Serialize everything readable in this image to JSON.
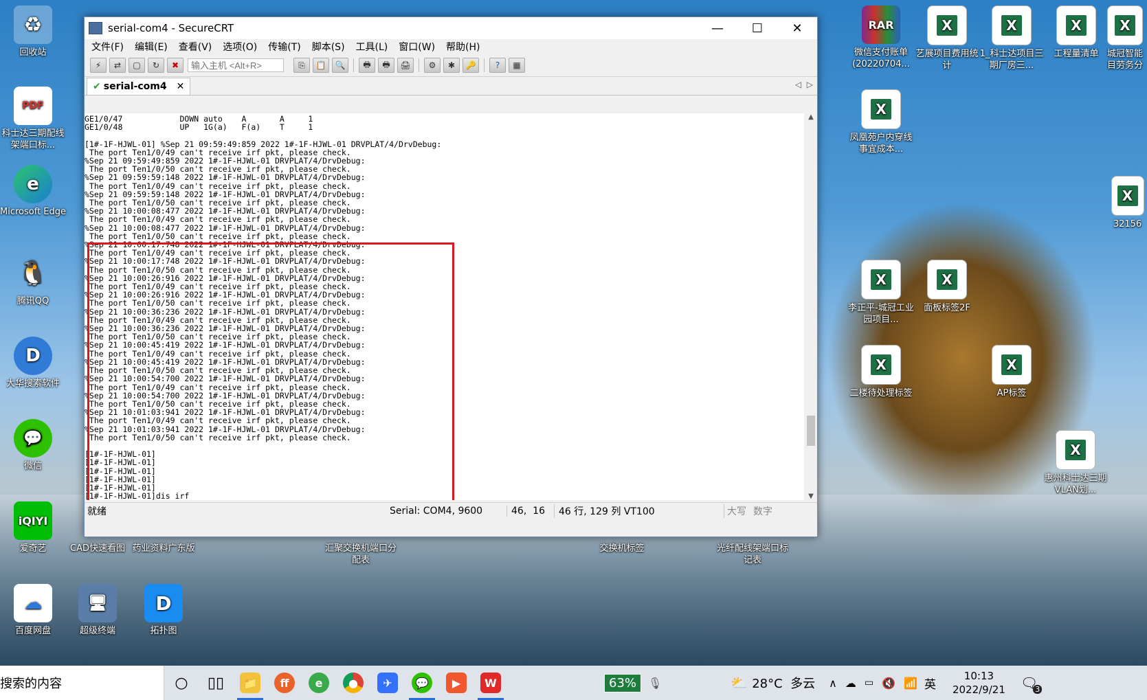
{
  "window": {
    "title": "serial-com4 - SecureCRT",
    "minimize": "—",
    "maximize": "☐",
    "close": "✕"
  },
  "menu": [
    "文件(F)",
    "编辑(E)",
    "查看(V)",
    "选项(O)",
    "传输(T)",
    "脚本(S)",
    "工具(L)",
    "窗口(W)",
    "帮助(H)"
  ],
  "toolbar": {
    "host_placeholder": "输入主机 <Alt+R>"
  },
  "tab": {
    "label": "serial-com4",
    "close": "✕"
  },
  "terminal": {
    "lines": [
      "GE1/0/47            DOWN auto    A       A     1",
      "GE1/0/48            UP   1G(a)   F(a)    T     1",
      "",
      "[1#-1F-HJWL-01] %Sep 21 09:59:49:859 2022 1#-1F-HJWL-01 DRVPLAT/4/DrvDebug:",
      " The port Ten1/0/49 can't receive irf pkt, please check.",
      "%Sep 21 09:59:49:859 2022 1#-1F-HJWL-01 DRVPLAT/4/DrvDebug:",
      " The port Ten1/0/50 can't receive irf pkt, please check.",
      "%Sep 21 09:59:59:148 2022 1#-1F-HJWL-01 DRVPLAT/4/DrvDebug:",
      " The port Ten1/0/49 can't receive irf pkt, please check.",
      "%Sep 21 09:59:59:148 2022 1#-1F-HJWL-01 DRVPLAT/4/DrvDebug:",
      " The port Ten1/0/50 can't receive irf pkt, please check.",
      "%Sep 21 10:00:08:477 2022 1#-1F-HJWL-01 DRVPLAT/4/DrvDebug:",
      " The port Ten1/0/49 can't receive irf pkt, please check.",
      "%Sep 21 10:00:08:477 2022 1#-1F-HJWL-01 DRVPLAT/4/DrvDebug:",
      " The port Ten1/0/50 can't receive irf pkt, please check.",
      "%Sep 21 10:00:17:748 2022 1#-1F-HJWL-01 DRVPLAT/4/DrvDebug:",
      " The port Ten1/0/49 can't receive irf pkt, please check.",
      "%Sep 21 10:00:17:748 2022 1#-1F-HJWL-01 DRVPLAT/4/DrvDebug:",
      " The port Ten1/0/50 can't receive irf pkt, please check.",
      "%Sep 21 10:00:26:916 2022 1#-1F-HJWL-01 DRVPLAT/4/DrvDebug:",
      " The port Ten1/0/49 can't receive irf pkt, please check.",
      "%Sep 21 10:00:26:916 2022 1#-1F-HJWL-01 DRVPLAT/4/DrvDebug:",
      " The port Ten1/0/50 can't receive irf pkt, please check.",
      "%Sep 21 10:00:36:236 2022 1#-1F-HJWL-01 DRVPLAT/4/DrvDebug:",
      " The port Ten1/0/49 can't receive irf pkt, please check.",
      "%Sep 21 10:00:36:236 2022 1#-1F-HJWL-01 DRVPLAT/4/DrvDebug:",
      " The port Ten1/0/50 can't receive irf pkt, please check.",
      "%Sep 21 10:00:45:419 2022 1#-1F-HJWL-01 DRVPLAT/4/DrvDebug:",
      " The port Ten1/0/49 can't receive irf pkt, please check.",
      "%Sep 21 10:00:45:419 2022 1#-1F-HJWL-01 DRVPLAT/4/DrvDebug:",
      " The port Ten1/0/50 can't receive irf pkt, please check.",
      "%Sep 21 10:00:54:700 2022 1#-1F-HJWL-01 DRVPLAT/4/DrvDebug:",
      " The port Ten1/0/49 can't receive irf pkt, please check.",
      "%Sep 21 10:00:54:700 2022 1#-1F-HJWL-01 DRVPLAT/4/DrvDebug:",
      " The port Ten1/0/50 can't receive irf pkt, please check.",
      "%Sep 21 10:01:03:941 2022 1#-1F-HJWL-01 DRVPLAT/4/DrvDebug:",
      " The port Ten1/0/49 can't receive irf pkt, please check.",
      "%Sep 21 10:01:03:941 2022 1#-1F-HJWL-01 DRVPLAT/4/DrvDebug:",
      " The port Ten1/0/50 can't receive irf pkt, please check.",
      "",
      "[1#-1F-HJWL-01]",
      "[1#-1F-HJWL-01]",
      "[1#-1F-HJWL-01]",
      "[1#-1F-HJWL-01]",
      "[1#-1F-HJWL-01]",
      "[1#-1F-HJWL-01]dis irf"
    ]
  },
  "status": {
    "ready": "就绪",
    "connection": "Serial: COM4, 9600",
    "cursor": "46,  16",
    "size": "46 行, 129 列 VT100",
    "caps": "大写",
    "num": "数字"
  },
  "desktop_icons": [
    {
      "label": "回收站",
      "icon": "recycle-bin"
    },
    {
      "label": "科士达三期配线架端口标...",
      "icon": "pdf"
    },
    {
      "label": "Microsoft Edge",
      "icon": "edge"
    },
    {
      "label": "腾讯QQ",
      "icon": "qq"
    },
    {
      "label": "大华搜索软件",
      "icon": "dahua"
    },
    {
      "label": "微信",
      "icon": "wechat"
    },
    {
      "label": "爱奇艺",
      "icon": "iqiyi"
    },
    {
      "label": "百度网盘",
      "icon": "baidu-netdisk"
    },
    {
      "label": "CAD快速看图",
      "icon": "cad"
    },
    {
      "label": "药业资料广东版",
      "icon": "folder"
    },
    {
      "label": "超级终端",
      "icon": "terminal"
    },
    {
      "label": "拓扑图",
      "icon": "topology"
    },
    {
      "label": "汇聚交换机端口分配表",
      "icon": "excel"
    },
    {
      "label": "交换机标签",
      "icon": "excel"
    },
    {
      "label": "光纤配线架端口标记表",
      "icon": "excel"
    },
    {
      "label": "微信支付账单(20220704...",
      "icon": "winrar"
    },
    {
      "label": "艺展项目费用统计",
      "icon": "excel"
    },
    {
      "label": "1_科士达项目三期厂房三...",
      "icon": "excel"
    },
    {
      "label": "工程量清单",
      "icon": "excel"
    },
    {
      "label": "城冠智能目劳务分",
      "icon": "excel"
    },
    {
      "label": "凤凰苑户内穿线事宜成本...",
      "icon": "excel"
    },
    {
      "label": "32156",
      "icon": "excel"
    },
    {
      "label": "李正平-城冠工业园项目...",
      "icon": "excel"
    },
    {
      "label": "面板标签2F",
      "icon": "excel"
    },
    {
      "label": "二楼待处理标签",
      "icon": "excel"
    },
    {
      "label": "AP标签",
      "icon": "excel"
    },
    {
      "label": "惠州科士达三期VLAN划...",
      "icon": "excel"
    }
  ],
  "taskbar": {
    "search_text": "搜索的内容",
    "battery": "63%",
    "weather": "28°C  多云",
    "ime": "英",
    "time": "10:13",
    "date": "2022/9/21",
    "notifications": "3"
  },
  "colors": {
    "highlight_box": "#e0141c",
    "excel_green": "#1e7145"
  }
}
